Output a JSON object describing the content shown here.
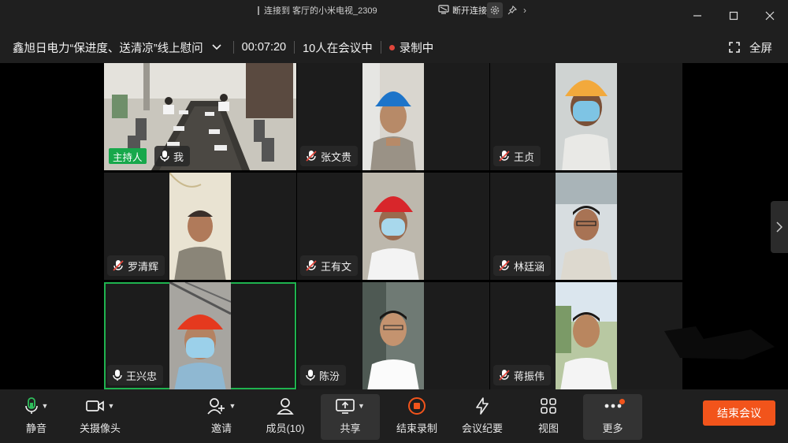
{
  "window": {
    "cast_banner": "连接到 客厅的小米电视_2309",
    "disconnect_label": "断开连接"
  },
  "info": {
    "meeting_title": "鑫旭日电力“保进度、送清凉”线上慰问",
    "elapsed": "00:07:20",
    "participants_text": "10人在会议中",
    "recording_text": "录制中",
    "fullscreen_label": "全屏"
  },
  "tiles": [
    {
      "name": "我",
      "host_badge": "主持人",
      "muted": false
    },
    {
      "name": "张文贵",
      "muted": true
    },
    {
      "name": "王贞",
      "muted": true
    },
    {
      "name": "罗清辉",
      "muted": true
    },
    {
      "name": "王有文",
      "muted": true
    },
    {
      "name": "林廷涵",
      "muted": true
    },
    {
      "name": "王兴忠",
      "muted": false,
      "active_speaker": true
    },
    {
      "name": "陈汾",
      "muted": false
    },
    {
      "name": "蒋振伟",
      "muted": true
    }
  ],
  "toolbar": {
    "mute": "静音",
    "camera_off": "关摄像头",
    "invite": "邀请",
    "members": "成员(10)",
    "share": "共享",
    "end_recording": "结束录制",
    "minutes": "会议纪要",
    "view": "视图",
    "more": "更多",
    "end_meeting": "结束会议"
  },
  "colors": {
    "accent_green": "#1fb34f",
    "end_orange": "#f2541b",
    "record_red": "#e0463b"
  }
}
